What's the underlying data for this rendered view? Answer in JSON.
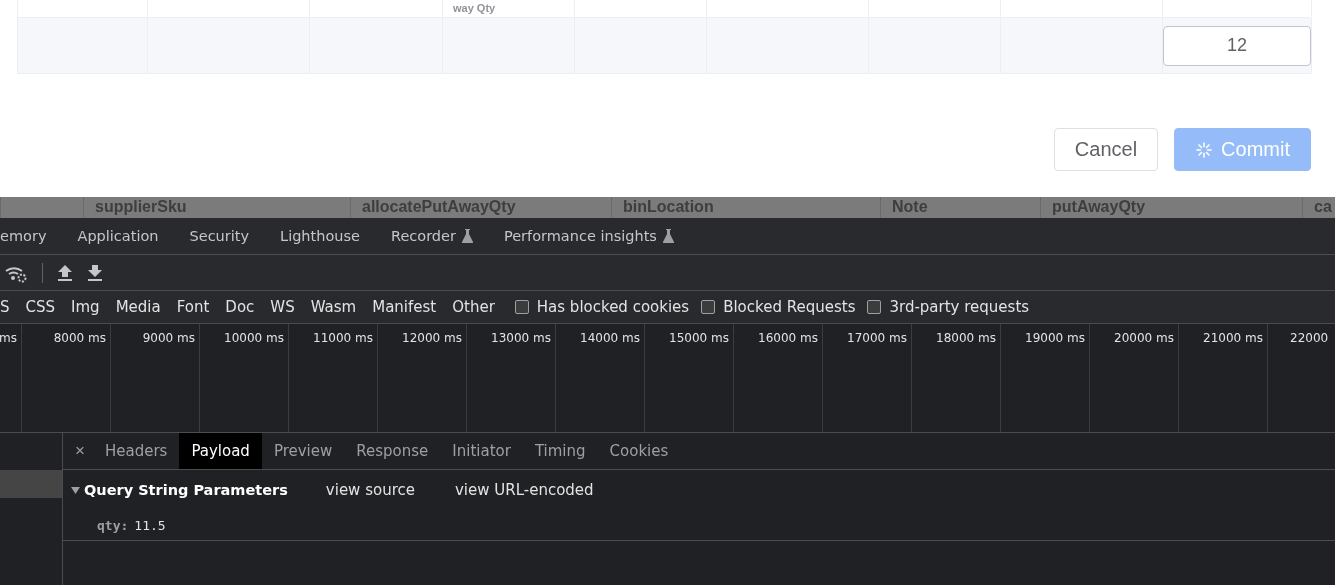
{
  "dialog_table": {
    "header_remnant": "way Qty",
    "row": {
      "qty_value": "12"
    }
  },
  "dialog_buttons": [
    {
      "label": "Cancel",
      "kind": "default",
      "loading": false
    },
    {
      "label": "Commit",
      "kind": "primary",
      "loading": true
    }
  ],
  "background_table_header": [
    "supplierSku",
    "allocatePutAwayQty",
    "binLocation",
    "Note",
    "putAwayQty",
    "ca"
  ],
  "devtools": {
    "panel_tabs": [
      {
        "label": "emory",
        "experimental": false
      },
      {
        "label": "Application",
        "experimental": false
      },
      {
        "label": "Security",
        "experimental": false
      },
      {
        "label": "Lighthouse",
        "experimental": false
      },
      {
        "label": "Recorder",
        "experimental": true
      },
      {
        "label": "Performance insights",
        "experimental": true
      }
    ],
    "filters": [
      "S",
      "CSS",
      "Img",
      "Media",
      "Font",
      "Doc",
      "WS",
      "Wasm",
      "Manifest",
      "Other"
    ],
    "filter_checkboxes": [
      {
        "label": "Has blocked cookies",
        "checked": false
      },
      {
        "label": "Blocked Requests",
        "checked": false
      },
      {
        "label": "3rd-party requests",
        "checked": false
      }
    ],
    "timeline_ticks": [
      "ms",
      "8000 ms",
      "9000 ms",
      "10000 ms",
      "11000 ms",
      "12000 ms",
      "13000 ms",
      "14000 ms",
      "15000 ms",
      "16000 ms",
      "17000 ms",
      "18000 ms",
      "19000 ms",
      "20000 ms",
      "21000 ms",
      "22000"
    ],
    "close_label": "×",
    "detail_tabs": [
      {
        "label": "Headers",
        "selected": false
      },
      {
        "label": "Payload",
        "selected": true
      },
      {
        "label": "Preview",
        "selected": false
      },
      {
        "label": "Response",
        "selected": false
      },
      {
        "label": "Initiator",
        "selected": false
      },
      {
        "label": "Timing",
        "selected": false
      },
      {
        "label": "Cookies",
        "selected": false
      }
    ],
    "payload": {
      "section_title": "Query String Parameters",
      "expanded": true,
      "links": [
        "view source",
        "view URL-encoded"
      ],
      "params": [
        {
          "key": "qty:",
          "value": "11.5"
        }
      ]
    }
  }
}
